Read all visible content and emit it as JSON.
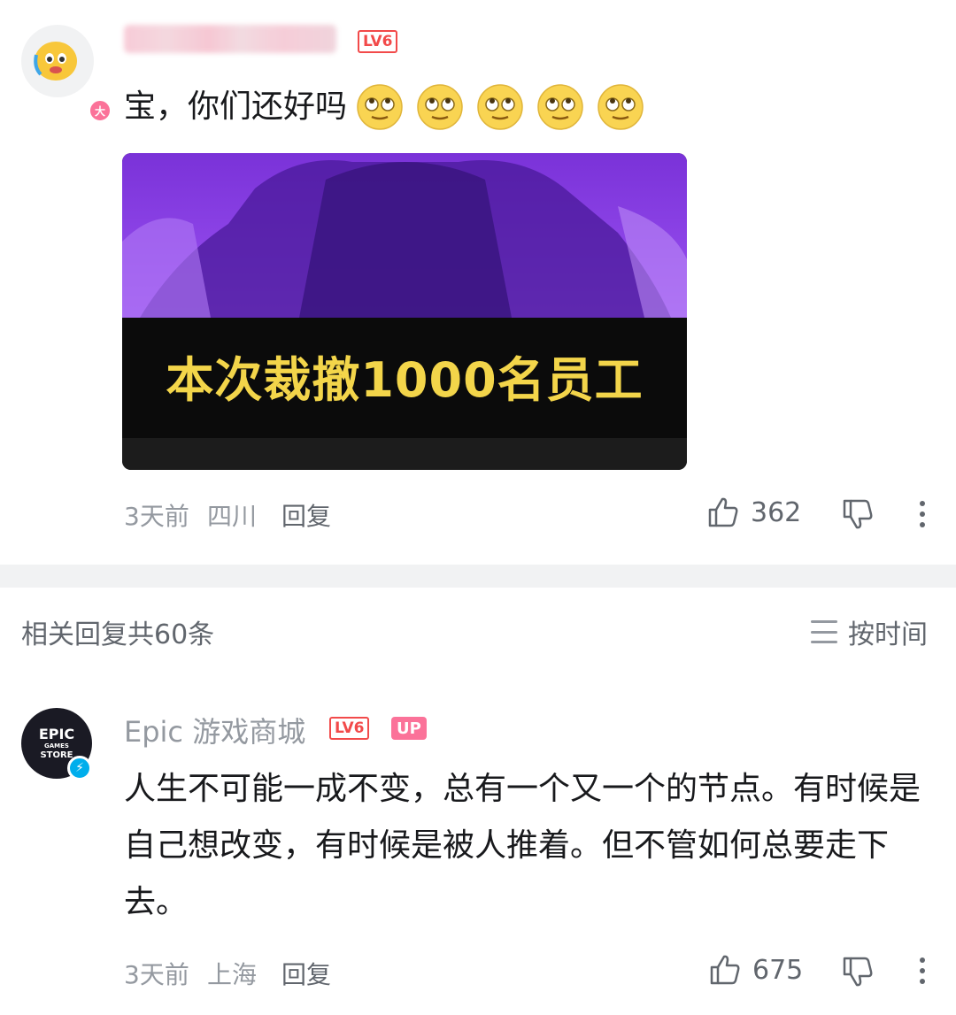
{
  "comment1": {
    "level": "LV6",
    "avatar_badge": "大",
    "text": "宝，你们还好吗",
    "emojis": [
      "eye-roll-emoji",
      "eye-roll-emoji",
      "eye-roll-emoji",
      "eye-roll-emoji",
      "eye-roll-emoji"
    ],
    "image_caption": "本次裁撤1000名员工",
    "time": "3天前",
    "location": "四川",
    "reply_label": "回复",
    "likes": "362"
  },
  "replies_header": {
    "count_label": "相关回复共60条",
    "sort_label": "按时间"
  },
  "comment2": {
    "username": "Epic 游戏商城",
    "level": "LV6",
    "up_badge": "UP",
    "avatar_text_line1": "EPIC",
    "avatar_text_line2": "GAMES",
    "avatar_text_line3": "STORE",
    "text": "人生不可能一成不变，总有一个又一个的节点。有时候是自己想改变，有时候是被人推着。但不管如何总要走下去。",
    "time": "3天前",
    "location": "上海",
    "reply_label": "回复",
    "likes": "675"
  },
  "colors": {
    "accent_pink": "#fb7299",
    "level_red": "#f24a4a",
    "caption_yellow": "#f3d54a",
    "image_purple": "#8e45e8",
    "verified_blue": "#00aeec"
  }
}
